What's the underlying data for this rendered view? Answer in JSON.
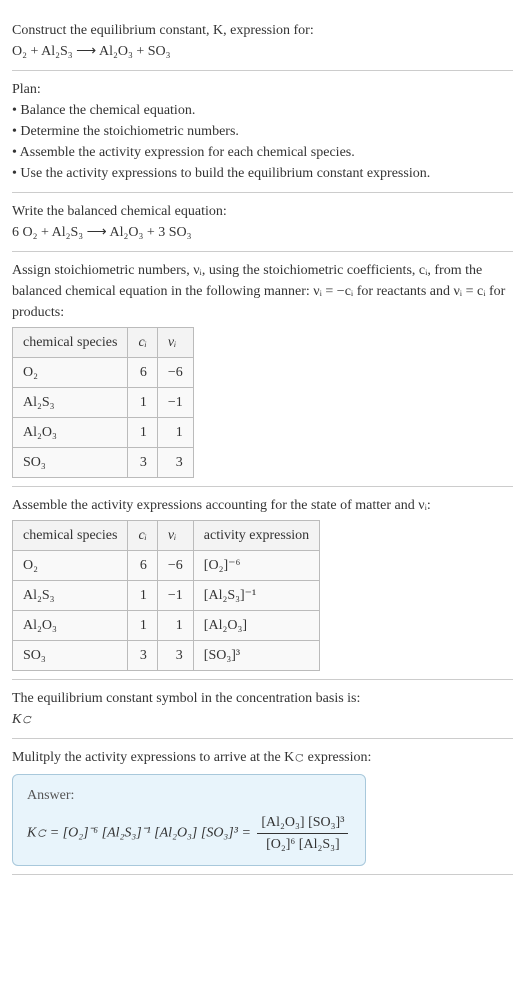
{
  "s1": {
    "prompt": "Construct the equilibrium constant, K, expression for:",
    "eq": "O₂ + Al₂S₃ ⟶ Al₂O₃ + SO₃"
  },
  "s2": {
    "heading": "Plan:",
    "b1": "Balance the chemical equation.",
    "b2": "Determine the stoichiometric numbers.",
    "b3": "Assemble the activity expression for each chemical species.",
    "b4": "Use the activity expressions to build the equilibrium constant expression."
  },
  "s3": {
    "heading": "Write the balanced chemical equation:",
    "eq": "6 O₂ + Al₂S₃ ⟶ Al₂O₃ + 3 SO₃"
  },
  "s4": {
    "para": "Assign stoichiometric numbers, νᵢ, using the stoichiometric coefficients, cᵢ, from the balanced chemical equation in the following manner: νᵢ = −cᵢ for reactants and νᵢ = cᵢ for products:",
    "th1": "chemical species",
    "th2": "cᵢ",
    "th3": "νᵢ",
    "r1c1": "O₂",
    "r1c2": "6",
    "r1c3": "−6",
    "r2c1": "Al₂S₃",
    "r2c2": "1",
    "r2c3": "−1",
    "r3c1": "Al₂O₃",
    "r3c2": "1",
    "r3c3": "1",
    "r4c1": "SO₃",
    "r4c2": "3",
    "r4c3": "3"
  },
  "s5": {
    "para": "Assemble the activity expressions accounting for the state of matter and νᵢ:",
    "th1": "chemical species",
    "th2": "cᵢ",
    "th3": "νᵢ",
    "th4": "activity expression",
    "r1c1": "O₂",
    "r1c2": "6",
    "r1c3": "−6",
    "r1c4": "[O₂]⁻⁶",
    "r2c1": "Al₂S₃",
    "r2c2": "1",
    "r2c3": "−1",
    "r2c4": "[Al₂S₃]⁻¹",
    "r3c1": "Al₂O₃",
    "r3c2": "1",
    "r3c3": "1",
    "r3c4": "[Al₂O₃]",
    "r4c1": "SO₃",
    "r4c2": "3",
    "r4c3": "3",
    "r4c4": "[SO₃]³"
  },
  "s6": {
    "para": "The equilibrium constant symbol in the concentration basis is:",
    "sym": "K𝚌"
  },
  "s7": {
    "para": "Mulitply the activity expressions to arrive at the K𝚌 expression:"
  },
  "ans": {
    "label": "Answer:",
    "lhs": "K𝚌 = [O₂]⁻⁶ [Al₂S₃]⁻¹ [Al₂O₃] [SO₃]³ = ",
    "num": "[Al₂O₃] [SO₃]³",
    "den": "[O₂]⁶ [Al₂S₃]"
  }
}
